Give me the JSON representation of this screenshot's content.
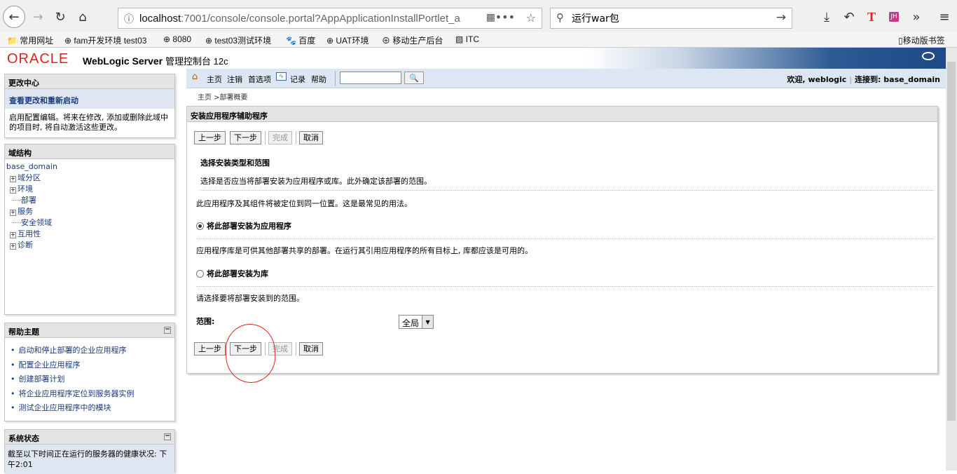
{
  "browser": {
    "url_host": "localhost",
    "url_rest": ":7001/console/console.portal?AppApplicationInstallPortlet_a",
    "search_query": "运行war包",
    "bookmarks": [
      "常用网址",
      "fam开发环境 test03",
      "8080",
      "test03测试环境",
      "百度",
      "UAT环境",
      "移动生产后台",
      "ITC"
    ],
    "mobile_bookmarks": "移动版书签",
    "ext_label": "JH"
  },
  "header": {
    "logo": "ORACLE",
    "product": "WebLogic Server",
    "subtitle": "管理控制台 12c"
  },
  "change_center": {
    "title": "更改中心",
    "link": "查看更改和重新启动",
    "text": "启用配置编辑。将来在修改, 添加或删除此域中的项目时, 将自动激活这些更改。"
  },
  "domain_structure": {
    "title": "域结构",
    "root": "base_domain",
    "nodes": [
      {
        "label": "域分区",
        "expandable": "+"
      },
      {
        "label": "环境",
        "expandable": "+"
      },
      {
        "label": "部署",
        "expandable": ""
      },
      {
        "label": "服务",
        "expandable": "+"
      },
      {
        "label": "安全领域",
        "expandable": ""
      },
      {
        "label": "互用性",
        "expandable": "+"
      },
      {
        "label": "诊断",
        "expandable": "+"
      }
    ]
  },
  "help_topics": {
    "title": "帮助主题",
    "minimize": "−",
    "items": [
      "启动和停止部署的企业应用程序",
      "配置企业应用程序",
      "创建部署计划",
      "将企业应用程序定位到服务器实例",
      "测试企业应用程序中的模块"
    ]
  },
  "system_status": {
    "title": "系统状态",
    "minimize": "−",
    "text": "截至以下时间正在运行的服务器的健康状况: 下午2:01"
  },
  "toolbar": {
    "home": "主页",
    "logout": "注销",
    "preferences": "首选项",
    "record": "记录",
    "help": "帮助",
    "search_placeholder": "",
    "welcome": "欢迎, weblogic",
    "connected": "连接到: base_domain"
  },
  "breadcrumb": "主页 >部署概要",
  "wizard": {
    "title": "安装应用程序辅助程序",
    "buttons": {
      "back": "上一步",
      "next": "下一步",
      "finish": "完成",
      "cancel": "取消"
    },
    "section_title": "选择安装类型和范围",
    "section_desc": "选择是否应当将部署安装为应用程序或库。此外确定该部署的范围。",
    "app_desc": "此应用程序及其组件将被定位到同一位置。这是最常见的用法。",
    "option_app": "将此部署安装为应用程序",
    "lib_desc": "应用程序库是可供其他部署共享的部署。在运行其引用应用程序的所有目标上, 库都应该是可用的。",
    "option_lib": "将此部署安装为库",
    "scope_desc": "请选择要将部署安装到的范围。",
    "scope_label": "范围:",
    "scope_value": "全局",
    "selected_option": "application"
  }
}
